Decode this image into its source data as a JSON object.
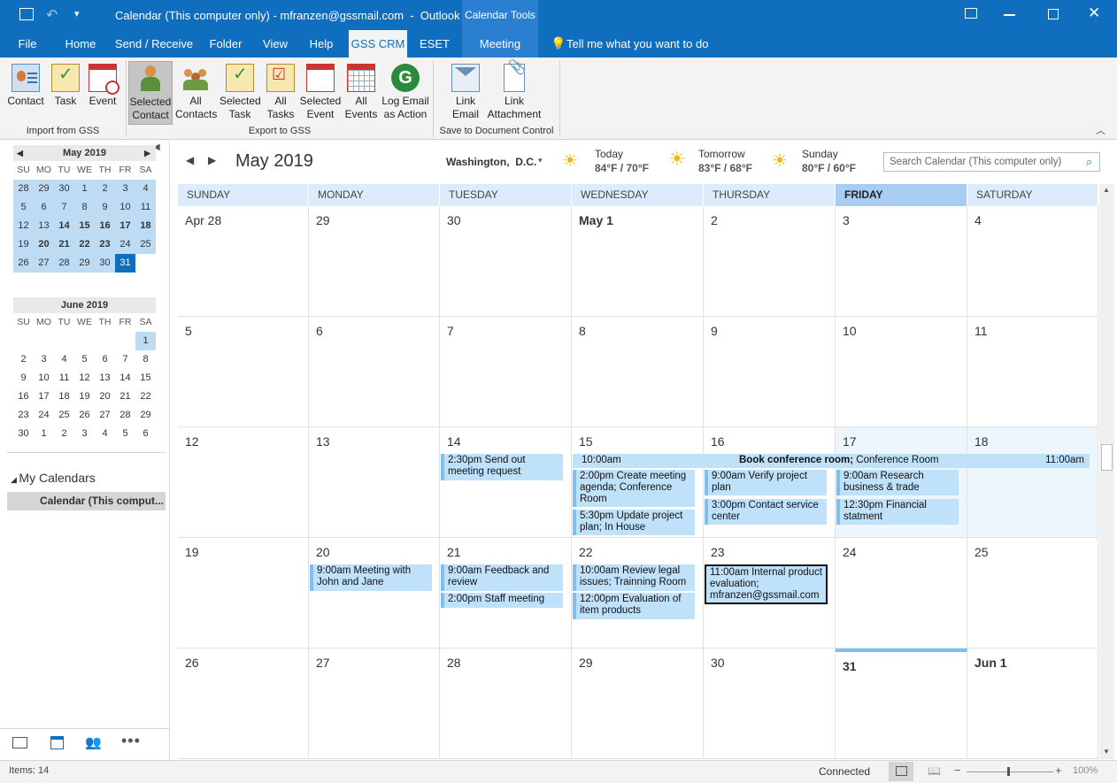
{
  "title_bar": {
    "title": "Calendar (This computer only) - mfranzen@gssmail.com  -  Outlook",
    "contextual_tab_group": "Calendar Tools"
  },
  "tabs": [
    "File",
    "Home",
    "Send / Receive",
    "Folder",
    "View",
    "Help",
    "GSS CRM",
    "ESET",
    "Meeting"
  ],
  "tell_me": "Tell me what you want to do",
  "ribbon": {
    "buttons": [
      {
        "line1": "Contact",
        "line2": ""
      },
      {
        "line1": "Task",
        "line2": ""
      },
      {
        "line1": "Event",
        "line2": ""
      },
      {
        "line1": "Selected",
        "line2": "Contact"
      },
      {
        "line1": "All",
        "line2": "Contacts"
      },
      {
        "line1": "Selected",
        "line2": "Task"
      },
      {
        "line1": "All",
        "line2": "Tasks"
      },
      {
        "line1": "Selected",
        "line2": "Event"
      },
      {
        "line1": "All",
        "line2": "Events"
      },
      {
        "line1": "Log Email",
        "line2": "as Action"
      },
      {
        "line1": "Link",
        "line2": "Email"
      },
      {
        "line1": "Link",
        "line2": "Attachment"
      }
    ],
    "groups": [
      "Import from GSS",
      "Export to GSS",
      "Save to Document Control"
    ]
  },
  "mini_may": {
    "title": "May 2019",
    "dow": [
      "SU",
      "MO",
      "TU",
      "WE",
      "TH",
      "FR",
      "SA"
    ],
    "weeks": [
      [
        "28",
        "29",
        "30",
        "1",
        "2",
        "3",
        "4"
      ],
      [
        "5",
        "6",
        "7",
        "8",
        "9",
        "10",
        "11"
      ],
      [
        "12",
        "13",
        "14",
        "15",
        "16",
        "17",
        "18"
      ],
      [
        "19",
        "20",
        "21",
        "22",
        "23",
        "24",
        "25"
      ],
      [
        "26",
        "27",
        "28",
        "29",
        "30",
        "31",
        ""
      ]
    ]
  },
  "mini_june": {
    "title": "June 2019",
    "dow": [
      "SU",
      "MO",
      "TU",
      "WE",
      "TH",
      "FR",
      "SA"
    ],
    "weeks": [
      [
        "",
        "",
        "",
        "",
        "",
        "",
        "1"
      ],
      [
        "2",
        "3",
        "4",
        "5",
        "6",
        "7",
        "8"
      ],
      [
        "9",
        "10",
        "11",
        "12",
        "13",
        "14",
        "15"
      ],
      [
        "16",
        "17",
        "18",
        "19",
        "20",
        "21",
        "22"
      ],
      [
        "23",
        "24",
        "25",
        "26",
        "27",
        "28",
        "29"
      ],
      [
        "30",
        "1",
        "2",
        "3",
        "4",
        "5",
        "6"
      ]
    ]
  },
  "my_calendars": {
    "label": "My Calendars",
    "item": "Calendar (This comput..."
  },
  "calendar": {
    "month_title": "May 2019",
    "location": "Washington,  D.C.",
    "weather": [
      {
        "day": "Today",
        "temp": "84°F / 70°F"
      },
      {
        "day": "Tomorrow",
        "temp": "83°F / 68°F"
      },
      {
        "day": "Sunday",
        "temp": "80°F / 60°F"
      }
    ],
    "search_placeholder": "Search Calendar (This computer only)",
    "day_headers": [
      "SUNDAY",
      "MONDAY",
      "TUESDAY",
      "WEDNESDAY",
      "THURSDAY",
      "FRIDAY",
      "SATURDAY"
    ],
    "weeks": [
      [
        "Apr 28",
        "29",
        "30",
        "May 1",
        "2",
        "3",
        "4"
      ],
      [
        "5",
        "6",
        "7",
        "8",
        "9",
        "10",
        "11"
      ],
      [
        "12",
        "13",
        "14",
        "15",
        "16",
        "17",
        "18"
      ],
      [
        "19",
        "20",
        "21",
        "22",
        "23",
        "24",
        "25"
      ],
      [
        "26",
        "27",
        "28",
        "29",
        "30",
        "31",
        "Jun 1"
      ]
    ],
    "appointments": {
      "a1": "2:30pm Send out meeting request",
      "a2_time": "10:00am",
      "a2_title": "Book conference room;",
      "a2_loc": " Conference Room",
      "a2_end": "11:00am",
      "a3": "2:00pm Create meeting agenda; Conference Room",
      "a4": "5:30pm Update project plan; In House",
      "a5": "9:00am Verify project plan",
      "a6": "3:00pm Contact service center",
      "a7": "9:00am Research business & trade",
      "a8": "12:30pm Financial statment",
      "a9": "9:00am Meeting with John and Jane",
      "a10": "9:00am Feedback and review",
      "a11": "2:00pm Staff meeting",
      "a12": "10:00am Review legal issues; Trainning Room",
      "a13": "12:00pm Evaluation of item products",
      "a14": "11:00am Internal product evaluation; mfranzen@gssmail.com"
    }
  },
  "status": {
    "items": "Items: 14",
    "connection": "Connected",
    "zoom": "100%"
  }
}
